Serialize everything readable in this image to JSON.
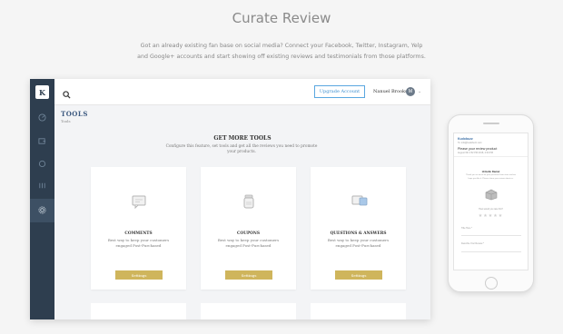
{
  "hero": {
    "title": "Curate Review",
    "description": "Got an already existing fan base on social media? Connect your Facebook, Twitter, Instagram, Yelp and Google+ accounts and start showing off existing reviews and testimonials from those platforms."
  },
  "app": {
    "logo_letter": "K",
    "topbar": {
      "upgrade_label": "Upgrade Account",
      "user_name": "Nanuel Brooks",
      "avatar_initial": "M"
    },
    "page": {
      "section_title": "TOOLS",
      "breadcrumb": "Tools",
      "get_more_title": "GET MORE TOOLS",
      "get_more_desc": "Configure this feature, set tools and get all the reviews you need to promote your products."
    },
    "cards": [
      {
        "title": "COMMENTS",
        "desc": "Best way to keep your customers engaged Post-Purchased",
        "button": "Settings",
        "icon": "comment-icon"
      },
      {
        "title": "COUPONS",
        "desc": "Best way to keep your customers engaged Post-Purchased",
        "button": "Settings",
        "icon": "coupon-jar-icon"
      },
      {
        "title": "QUESTIONS & ANSWERS",
        "desc": "Best way to keep your customers engaged Post-Purchased",
        "button": "Settings",
        "icon": "qa-chat-icon"
      }
    ]
  },
  "phone": {
    "brand": "Kudobuzz",
    "from": "To: info@kudobuzz.com",
    "subject": "Please your review product",
    "date": "August 6th 2:52 PM 2018, 4:00 PM",
    "hello": "Hi Hello Daniel",
    "message": "Thank you so much for your purchase from store and we hope you like it. Please share your review about us.",
    "rate_label": "How would you rate this?",
    "stars": "★★★★★",
    "field1": "Title Here *",
    "field2": "Describe Your Review *"
  },
  "colors": {
    "sidebar": "#2e3e4f",
    "accent_button": "#cfb55c",
    "upgrade_border": "#5aa7e0"
  }
}
